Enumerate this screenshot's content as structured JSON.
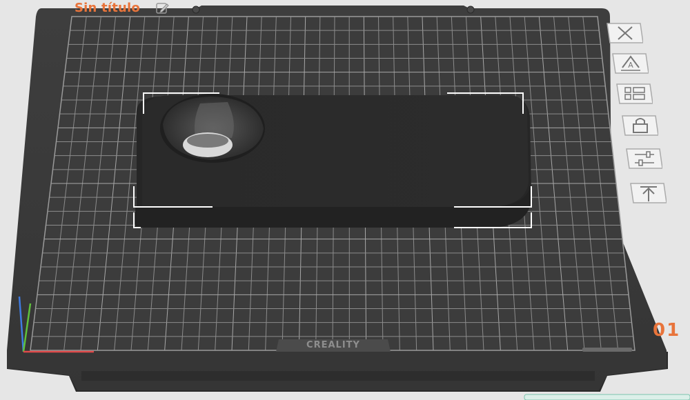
{
  "plate": {
    "title": "Sin título",
    "number": "01",
    "brand": "CREALITY"
  },
  "toolbar": [
    {
      "name": "delete-plate-button",
      "icon": "close-x-icon"
    },
    {
      "name": "auto-arrange-button",
      "icon": "arrange-a-icon"
    },
    {
      "name": "plate-settings-button",
      "icon": "grid-settings-icon"
    },
    {
      "name": "lock-plate-button",
      "icon": "lock-icon"
    },
    {
      "name": "plate-params-button",
      "icon": "sliders-icon"
    },
    {
      "name": "lay-on-face-button",
      "icon": "arrow-up-bar-icon"
    }
  ],
  "colors": {
    "accent": "#e8743b",
    "plate": "#3a3a3a",
    "grid": "#8a8a8a",
    "model": "#2b2b2b",
    "background": "#e6e6e6"
  }
}
